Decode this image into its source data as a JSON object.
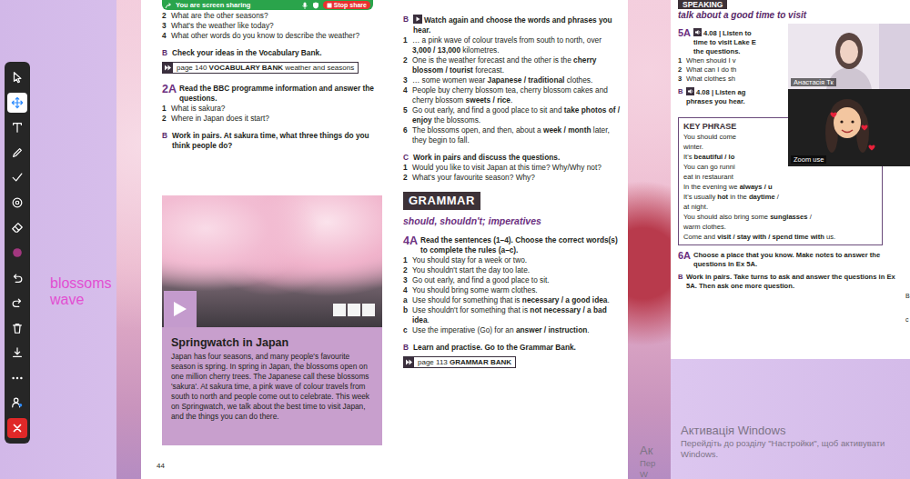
{
  "share_bar": {
    "label": "You are screen sharing",
    "stop": "Stop share"
  },
  "toolbar": {
    "tools": [
      {
        "kind": "cursor",
        "selected": false
      },
      {
        "kind": "move",
        "selected": true
      },
      {
        "kind": "text",
        "selected": false
      },
      {
        "kind": "pen",
        "selected": false
      },
      {
        "kind": "check",
        "selected": false
      },
      {
        "kind": "stamp",
        "selected": false
      },
      {
        "kind": "eraser",
        "selected": false
      },
      {
        "kind": "color",
        "selected": false,
        "color": "#a2377f"
      },
      {
        "kind": "undo",
        "selected": false
      },
      {
        "kind": "redo",
        "selected": false
      },
      {
        "kind": "trash",
        "selected": false
      },
      {
        "kind": "download",
        "selected": false
      },
      {
        "kind": "more",
        "selected": false
      },
      {
        "kind": "participant",
        "selected": false
      },
      {
        "kind": "close",
        "selected": false
      }
    ]
  },
  "annotation": {
    "lines": [
      "blossoms",
      "wave"
    ]
  },
  "left_page": {
    "blocks": [
      {
        "kind": "q",
        "label": "2",
        "parts": [
          "What are the other seasons?"
        ]
      },
      {
        "kind": "q",
        "label": "3",
        "parts": [
          "What's the weather like today?"
        ]
      },
      {
        "kind": "q",
        "label": "4",
        "parts": [
          "What other words do you know to describe the weather?"
        ]
      },
      {
        "kind": "sub",
        "label": "B",
        "parts": [
          "Check your ideas in the Vocabulary Bank."
        ]
      },
      {
        "kind": "link",
        "parts": [
          "page 140 ",
          "VOCABULARY BANK",
          " weather and seasons"
        ]
      },
      {
        "kind": "ex",
        "label": "2A",
        "parts": [
          "Read the BBC programme information and answer the questions."
        ]
      },
      {
        "kind": "q",
        "label": "1",
        "parts": [
          "What is sakura?"
        ]
      },
      {
        "kind": "q",
        "label": "2",
        "parts": [
          "Where in Japan does it start?"
        ]
      },
      {
        "kind": "sub",
        "label": "B",
        "parts": [
          "Work in pairs. At sakura time, what three things do you think people do?"
        ]
      }
    ],
    "article": {
      "title": "Springwatch in Japan",
      "body": "Japan has four seasons, and many people's favourite season is spring. In spring in Japan, the blossoms open on one million cherry trees. The Japanese call these blossoms 'sakura'. At sakura time, a pink wave of colour travels from south to north and people come out to celebrate. This week on Springwatch, we talk about the best time to visit Japan, and the things you can do there."
    },
    "page_number": "44"
  },
  "right_page": {
    "blocks": [
      {
        "kind": "video",
        "label": "B",
        "parts": [
          "Watch again and choose the words and phrases you hear."
        ]
      },
      {
        "kind": "q",
        "label": "1",
        "parts": [
          "… a pink wave of colour travels from south to north, over ",
          "3,000 / 13,000",
          " kilometres."
        ]
      },
      {
        "kind": "q",
        "label": "2",
        "parts": [
          "One is the weather forecast and the other is the ",
          "cherry blossom / tourist",
          " forecast."
        ]
      },
      {
        "kind": "q",
        "label": "3",
        "parts": [
          "… some women wear ",
          "Japanese / traditional",
          " clothes."
        ]
      },
      {
        "kind": "q",
        "label": "4",
        "parts": [
          "People buy cherry blossom tea, cherry blossom cakes and cherry blossom ",
          "sweets / rice",
          "."
        ]
      },
      {
        "kind": "q",
        "label": "5",
        "parts": [
          "Go out early, and find a good place to sit and ",
          "take photos of / enjoy",
          " the blossoms."
        ]
      },
      {
        "kind": "q",
        "label": "6",
        "parts": [
          "The blossoms open, and then, about a ",
          "week / month",
          " later, they begin to fall."
        ]
      },
      {
        "kind": "sub",
        "label": "C",
        "parts": [
          "Work in pairs and discuss the questions."
        ]
      },
      {
        "kind": "q",
        "label": "1",
        "parts": [
          "Would you like to visit Japan at this time? Why/Why not?"
        ]
      },
      {
        "kind": "q",
        "label": "2",
        "parts": [
          "What's your favourite season? Why?"
        ]
      },
      {
        "kind": "header",
        "parts": [
          "GRAMMAR"
        ]
      },
      {
        "kind": "subhead",
        "parts": [
          "should, shouldn't; imperatives"
        ]
      },
      {
        "kind": "ex",
        "label": "4A",
        "parts": [
          "Read the sentences (1–4). Choose the correct words(s) to complete the rules (a–c)."
        ]
      },
      {
        "kind": "q",
        "label": "1",
        "parts": [
          "You should stay for a week or two."
        ]
      },
      {
        "kind": "q",
        "label": "2",
        "parts": [
          "You shouldn't start the day too late."
        ]
      },
      {
        "kind": "q",
        "label": "3",
        "parts": [
          "Go out early, and find a good place to sit."
        ]
      },
      {
        "kind": "q",
        "label": "4",
        "parts": [
          "You should bring some warm clothes."
        ]
      },
      {
        "kind": "q",
        "label": "a",
        "parts": [
          "Use should for something that is ",
          "necessary / a good idea",
          "."
        ]
      },
      {
        "kind": "q",
        "label": "b",
        "parts": [
          "Use shouldn't for something that is ",
          "not necessary / a bad idea",
          "."
        ]
      },
      {
        "kind": "q",
        "label": "c",
        "parts": [
          "Use the imperative (Go) for an ",
          "answer / instruction",
          "."
        ]
      },
      {
        "kind": "sub",
        "label": "B",
        "parts": [
          "Learn and practise. Go to the Grammar Bank."
        ]
      },
      {
        "kind": "link",
        "parts": [
          "page 113 ",
          "GRAMMAR BANK"
        ]
      }
    ]
  },
  "speaking_page": {
    "header": "SPEAKING",
    "title": "talk about a good time to visit",
    "blocks": [
      {
        "kind": "audio-ex",
        "label": "5A",
        "lines": [
          "4.08 | Listen to",
          "time to visit Lake E",
          "the questions."
        ]
      },
      {
        "kind": "q",
        "label": "1",
        "parts": [
          "When should I v"
        ]
      },
      {
        "kind": "q",
        "label": "2",
        "parts": [
          "What can I do th"
        ]
      },
      {
        "kind": "q",
        "label": "3",
        "parts": [
          "What clothes sh"
        ]
      },
      {
        "kind": "audio-sub",
        "label": "B",
        "lines": [
          "4.08 | Listen ag",
          "phrases you hear."
        ]
      }
    ],
    "key_phrases": {
      "title": "KEY PHRASE",
      "lines": [
        {
          "parts": [
            "You should come"
          ]
        },
        {
          "parts": [
            "winter."
          ]
        },
        {
          "parts": [
            "It's ",
            "beautiful / lo"
          ]
        },
        {
          "parts": [
            "You can go runni"
          ]
        },
        {
          "parts": [
            "eat in restaurant"
          ]
        },
        {
          "parts": [
            "In the evening we ",
            "always / u"
          ]
        },
        {
          "parts": [
            "It's usually ",
            "hot",
            " in the ",
            "daytime",
            " /"
          ]
        },
        {
          "parts": [
            "at night."
          ]
        },
        {
          "parts": [
            "You should also bring some ",
            "sunglasses",
            " /"
          ]
        },
        {
          "parts": [
            "warm clothes."
          ]
        },
        {
          "parts": [
            "Come and ",
            "visit / stay with / spend time with",
            " us."
          ]
        }
      ]
    },
    "tail": [
      {
        "kind": "ex",
        "label": "6A",
        "parts": [
          "Choose a place that you know. Make notes to answer the questions in Ex 5A."
        ]
      },
      {
        "kind": "sub",
        "label": "B",
        "parts": [
          "Work in pairs. Take turns to ask and answer the questions in Ex 5A. Then ask one more question."
        ]
      }
    ]
  },
  "edge_letters": [
    "B",
    "c"
  ],
  "video": {
    "tiles": [
      {
        "name": "Анастасія Тк"
      },
      {
        "name": "Zoom use"
      }
    ]
  },
  "watermark": {
    "title": "Активація Windows",
    "text": "Перейдіть до розділу \"Настройки\", щоб активувати Windows."
  },
  "ghost_watermark": [
    "Ак",
    "Пер",
    "W"
  ]
}
